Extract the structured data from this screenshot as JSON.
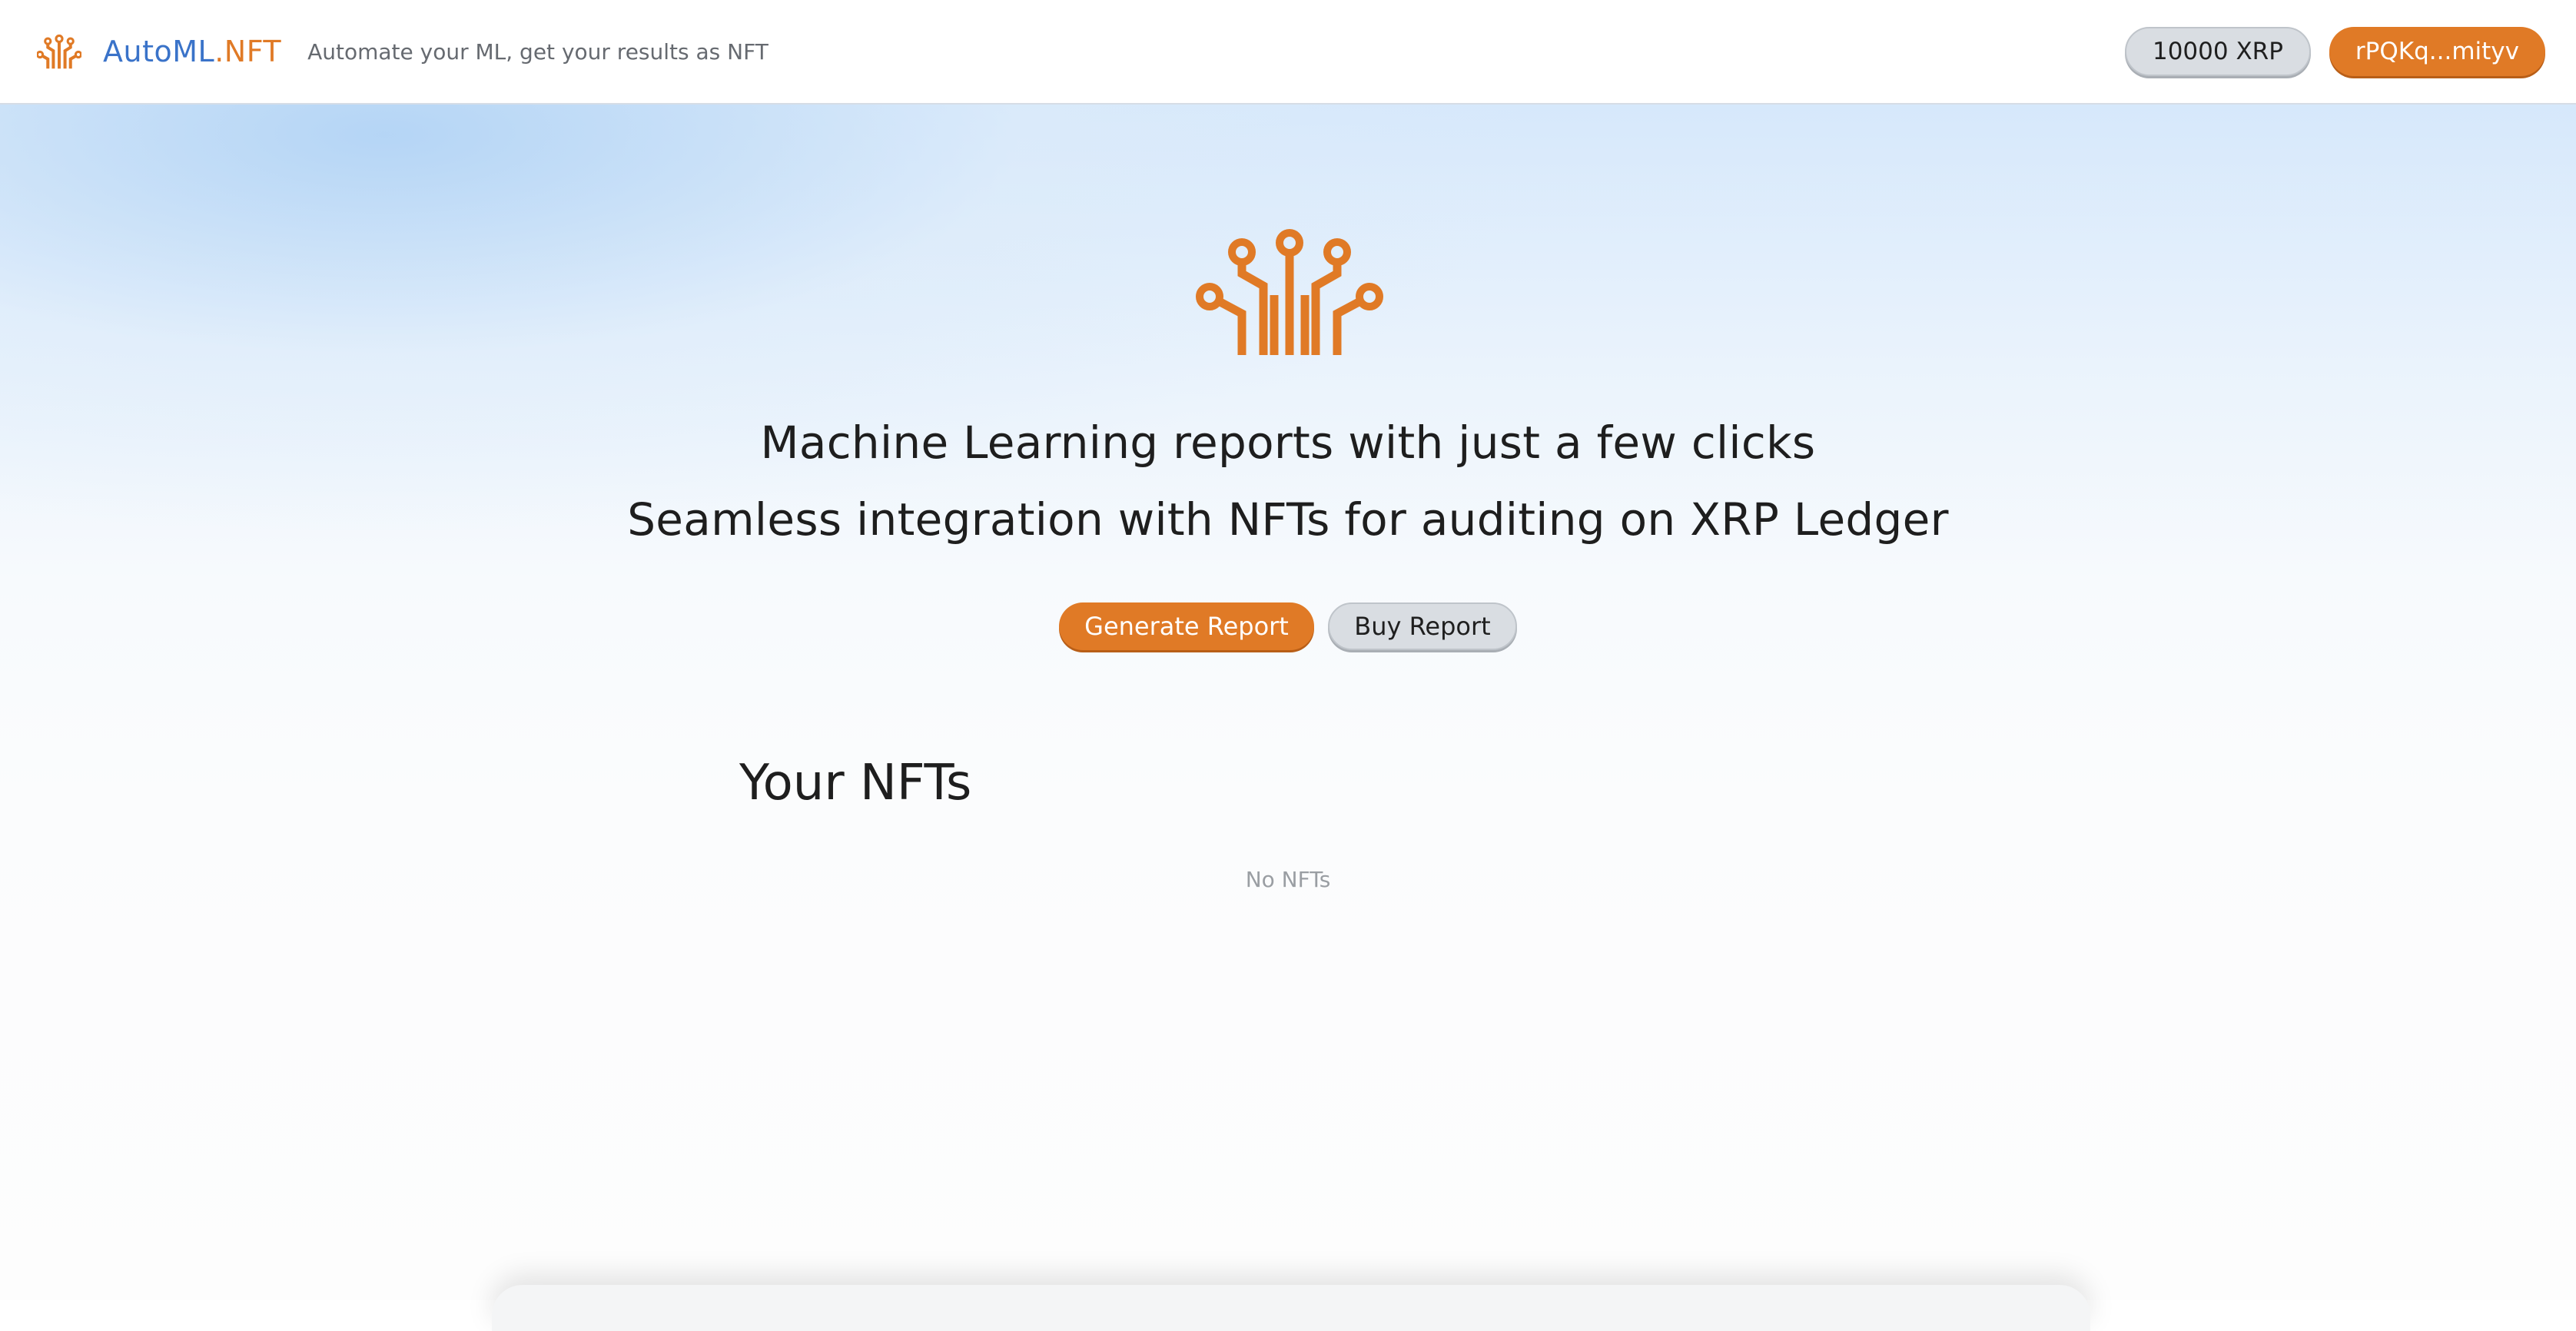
{
  "brand": {
    "name_part1": "AutoML",
    "name_part2": ".NFT",
    "tagline": "Automate your ML, get your results as NFT",
    "logo_icon": "circuit-tree-icon"
  },
  "header": {
    "balance_label": "10000 XRP",
    "account_label": "rPQKq...mityv"
  },
  "hero": {
    "icon": "circuit-tree-icon",
    "line1": "Machine Learning reports with just a few clicks",
    "line2": "Seamless integration with NFTs for auditing on XRP Ledger",
    "generate_label": "Generate Report",
    "buy_label": "Buy Report"
  },
  "nfts": {
    "title": "Your NFTs",
    "empty_text": "No NFTs"
  },
  "colors": {
    "accent": "#e07a26",
    "brand_blue": "#3a73c9",
    "pill_grey": "#d9dde2"
  }
}
